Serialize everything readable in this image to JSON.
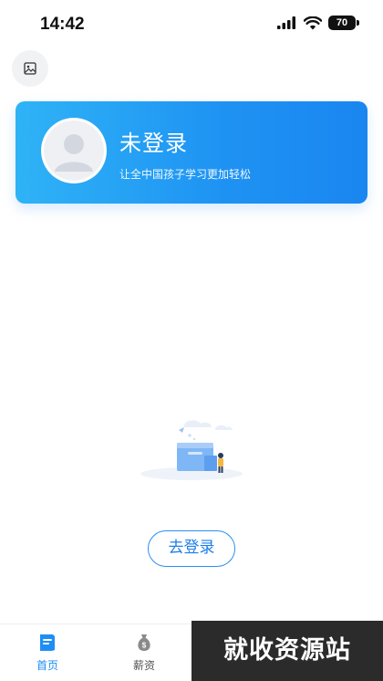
{
  "status_bar": {
    "time": "14:42",
    "battery": "70",
    "icons": [
      "signal-icon",
      "wifi-icon",
      "battery-icon"
    ]
  },
  "header": {
    "image_button_icon": "image-icon"
  },
  "profile": {
    "status": "未登录",
    "slogan": "让全中国孩子学习更加轻松",
    "avatar_icon": "default-avatar-icon",
    "card_gradient": [
      "#2fb3f6",
      "#1a86f0"
    ]
  },
  "empty_state": {
    "illustration": "empty-box-illustration",
    "login_label": "去登录"
  },
  "tab_bar": {
    "items": [
      {
        "label": "首页",
        "icon": "home-doc-icon",
        "active": true
      },
      {
        "label": "薪资",
        "icon": "money-bag-icon",
        "active": false
      }
    ],
    "active_color": "#1e8ef5"
  },
  "watermark": {
    "text": "就收资源站"
  }
}
